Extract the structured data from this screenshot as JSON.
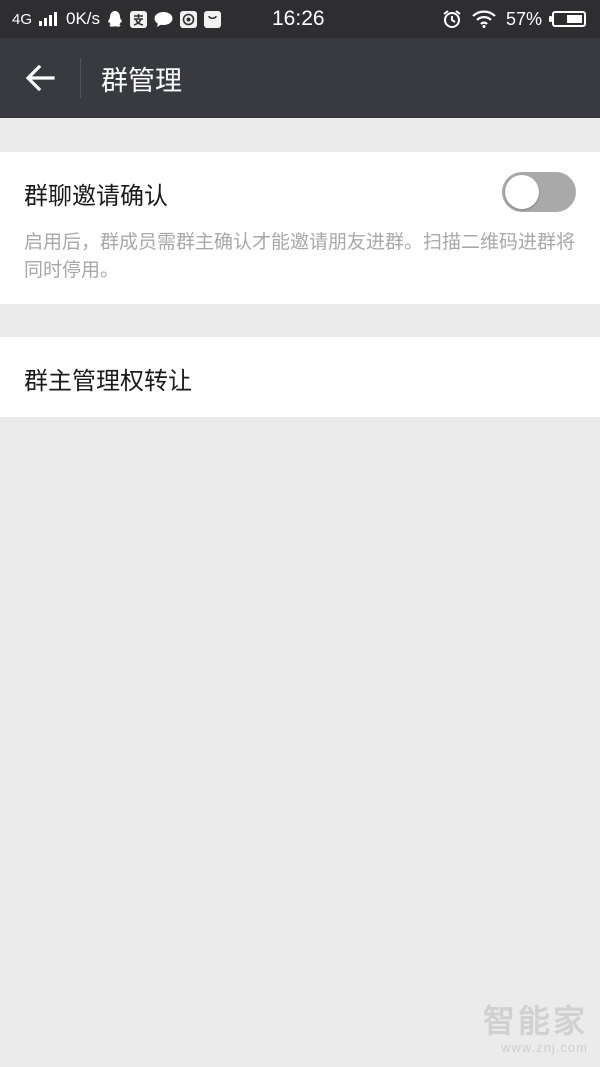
{
  "status_bar": {
    "network": "4G",
    "speed": "0K/s",
    "time": "16:26",
    "battery": "57%",
    "battery_level": 0.57,
    "icons": [
      "qq-icon",
      "alipay-icon",
      "chat-bubble-icon",
      "camera-app-icon",
      "shopping-bag-icon",
      "alarm-icon",
      "wifi-icon"
    ]
  },
  "app_bar": {
    "title": "群管理",
    "back_icon": "arrow-left-icon"
  },
  "settings": {
    "invite_confirm": {
      "label": "群聊邀请确认",
      "enabled": false,
      "description": "启用后，群成员需群主确认才能邀请朋友进群。扫描二维码进群将同时停用。"
    },
    "transfer_owner": {
      "label": "群主管理权转让"
    }
  },
  "watermark": {
    "title": "智能家",
    "url": "www.znj.com"
  },
  "colors": {
    "status_bar_bg": "#2e2e30",
    "app_bar_bg": "#393a3f",
    "page_bg": "#ebebeb",
    "toggle_off": "#a9a9a9"
  }
}
